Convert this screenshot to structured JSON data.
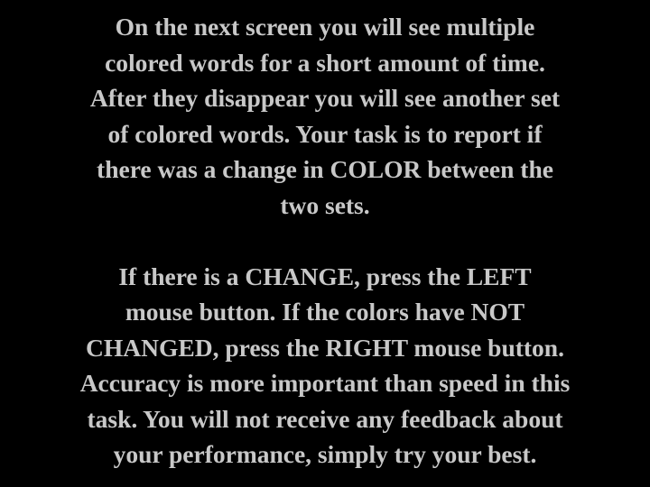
{
  "instructions": {
    "paragraph1": [
      "On the next screen you will see multiple",
      "colored words for a short amount of time.",
      "After they disappear you will see another set",
      "of colored words. Your task is to report if",
      "there was a change in COLOR between the",
      "two sets."
    ],
    "paragraph2": [
      "If there is a CHANGE, press the LEFT",
      "mouse button. If the colors have NOT",
      "CHANGED, press the RIGHT mouse button.",
      "Accuracy is more important than speed in this",
      "task. You will not receive any feedback about",
      "your performance, simply try your best."
    ]
  },
  "colors": {
    "background": "#000000",
    "text": "#c8c8c8"
  }
}
